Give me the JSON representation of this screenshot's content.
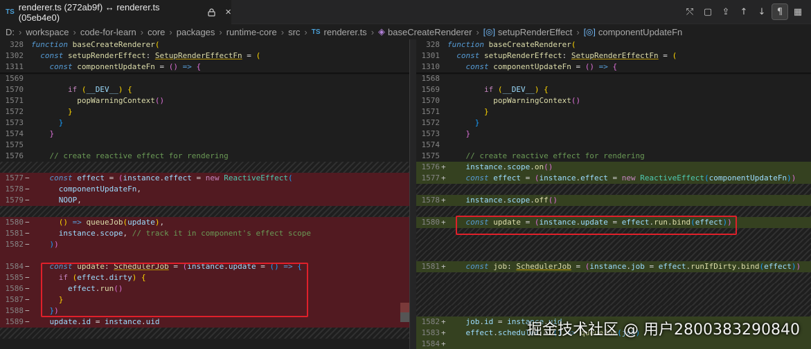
{
  "tab": {
    "title": "renderer.ts (272ab9f) ↔ renderer.ts (05eb4e0)",
    "type_badge": "TS",
    "close_glyph": "×",
    "lock_icon": "lock-icon"
  },
  "toolbar": {
    "actions": [
      {
        "name": "open-changes-icon",
        "glyph": "⤲"
      },
      {
        "name": "open-file-icon",
        "glyph": "▢"
      },
      {
        "name": "stage-icon",
        "glyph": "⇪"
      },
      {
        "name": "prev-change-icon",
        "glyph": "↑"
      },
      {
        "name": "next-change-icon",
        "glyph": "↓"
      },
      {
        "name": "pilcrow-icon",
        "glyph": "¶"
      },
      {
        "name": "map-icon",
        "glyph": "▦"
      }
    ]
  },
  "breadcrumb": {
    "segments": [
      "D:",
      "workspace",
      "code-for-learn",
      "core",
      "packages",
      "runtime-core",
      "src"
    ],
    "file": "renderer.ts",
    "symbols": [
      "baseCreateRenderer",
      "setupRenderEffect",
      "componentUpdateFn"
    ],
    "file_badge": "TS"
  },
  "left": {
    "sticky": [
      {
        "ln": "328",
        "html": "<span class='kw'>function</span> <span class='fn'>baseCreateRenderer</span><span class='p1'>(</span>"
      },
      {
        "ln": "1302",
        "html": "  <span class='kw'>const</span> <span class='fn'>setupRenderEffect</span>: <span class='ty'>SetupRenderEffectFn</span> = <span class='p1'>(</span>"
      },
      {
        "ln": "1311",
        "html": "    <span class='kw'>const</span> <span class='fn'>componentUpdateFn</span> = <span class='p2'>()</span> <span class='kw'>=></span> <span class='p2'>{</span>"
      }
    ],
    "lines": [
      {
        "ln": "1569",
        "mk": "",
        "cls": "",
        "html": ""
      },
      {
        "ln": "1570",
        "mk": "",
        "cls": "",
        "html": "        <span class='kw2'>if</span> <span class='p1'>(</span><span class='va'>__DEV__</span><span class='p1'>)</span> <span class='p1'>{</span>"
      },
      {
        "ln": "1571",
        "mk": "",
        "cls": "",
        "html": "          <span class='fn'>popWarningContext</span><span class='p2'>()</span>"
      },
      {
        "ln": "1572",
        "mk": "",
        "cls": "",
        "html": "        <span class='p1'>}</span>"
      },
      {
        "ln": "1573",
        "mk": "",
        "cls": "",
        "html": "      <span class='p3'>}</span>"
      },
      {
        "ln": "1574",
        "mk": "",
        "cls": "",
        "html": "    <span class='p2'>}</span>"
      },
      {
        "ln": "1575",
        "mk": "",
        "cls": "",
        "html": ""
      },
      {
        "ln": "1576",
        "mk": "",
        "cls": "",
        "html": "    <span class='cm'>// create reactive effect for rendering</span>"
      },
      {
        "ln": "",
        "mk": "",
        "cls": "hatch",
        "html": ""
      },
      {
        "ln": "1577",
        "mk": "−",
        "cls": "del",
        "html": "    <span class='kw'>const</span> <span class='va'>effect</span> = <span class='p2'>(</span><span class='va'>instance</span>.<span class='va'>effect</span> = <span class='kw2'>new</span> <span class='gt'>ReactiveEffect</span><span class='p3'>(</span>"
      },
      {
        "ln": "1578",
        "mk": "−",
        "cls": "del",
        "html": "      <span class='va'>componentUpdateFn</span>,"
      },
      {
        "ln": "1579",
        "mk": "−",
        "cls": "del",
        "html": "      <span class='va'>NOOP</span>,"
      },
      {
        "ln": "",
        "mk": "",
        "cls": "hatch",
        "html": ""
      },
      {
        "ln": "1580",
        "mk": "−",
        "cls": "del",
        "html": "      <span class='p1'>()</span> <span class='kw'>=></span> <span class='fn'>queueJob</span><span class='p1'>(</span><span class='va'>update</span><span class='p1'>)</span>,"
      },
      {
        "ln": "1581",
        "mk": "−",
        "cls": "del",
        "html": "      <span class='va'>instance</span>.<span class='va'>scope</span>, <span class='cm'>// track it in component's effect scope</span>"
      },
      {
        "ln": "1582",
        "mk": "−",
        "cls": "del",
        "html": "    <span class='p3'>)</span><span class='p2'>)</span>"
      },
      {
        "ln": "",
        "mk": "",
        "cls": "del",
        "html": ""
      },
      {
        "ln": "1584",
        "mk": "−",
        "cls": "del",
        "html": "    <span class='kw'>const</span> <span class='fn'>update</span>: <span class='ty'>SchedulerJob</span> = <span class='p2'>(</span><span class='va'>instance</span>.<span class='va'>update</span> = <span class='p3'>()</span> <span class='kw'>=></span> <span class='p3'>{</span>"
      },
      {
        "ln": "1585",
        "mk": "−",
        "cls": "del",
        "html": "      <span class='kw2'>if</span> <span class='p1'>(</span><span class='va'>effect</span>.<span class='va'>dirty</span><span class='p1'>)</span> <span class='p1'>{</span>"
      },
      {
        "ln": "1586",
        "mk": "−",
        "cls": "del",
        "html": "        <span class='va'>effect</span>.<span class='fn'>run</span><span class='p2'>()</span>"
      },
      {
        "ln": "1587",
        "mk": "−",
        "cls": "del",
        "html": "      <span class='p1'>}</span>"
      },
      {
        "ln": "1588",
        "mk": "−",
        "cls": "del",
        "html": "    <span class='p3'>}</span><span class='p2'>)</span>"
      },
      {
        "ln": "1589",
        "mk": "−",
        "cls": "del",
        "html": "    <span class='va'>update</span>.<span class='va'>id</span> = <span class='va'>instance</span>.<span class='va'>uid</span>"
      },
      {
        "ln": "",
        "mk": "",
        "cls": "hatch",
        "html": ""
      }
    ]
  },
  "right": {
    "sticky": [
      {
        "ln": "328",
        "html": "<span class='kw'>function</span> <span class='fn'>baseCreateRenderer</span><span class='p1'>(</span>"
      },
      {
        "ln": "1301",
        "html": "  <span class='kw'>const</span> <span class='fn'>setupRenderEffect</span>: <span class='ty'>SetupRenderEffectFn</span> = <span class='p1'>(</span>"
      },
      {
        "ln": "1310",
        "html": "    <span class='kw'>const</span> <span class='fn'>componentUpdateFn</span> = <span class='p2'>()</span> <span class='kw'>=></span> <span class='p2'>{</span>"
      }
    ],
    "lines": [
      {
        "ln": "1568",
        "mk": "",
        "cls": "",
        "html": ""
      },
      {
        "ln": "1569",
        "mk": "",
        "cls": "",
        "html": "        <span class='kw2'>if</span> <span class='p1'>(</span><span class='va'>__DEV__</span><span class='p1'>)</span> <span class='p1'>{</span>"
      },
      {
        "ln": "1570",
        "mk": "",
        "cls": "",
        "html": "          <span class='fn'>popWarningContext</span><span class='p2'>()</span>"
      },
      {
        "ln": "1571",
        "mk": "",
        "cls": "",
        "html": "        <span class='p1'>}</span>"
      },
      {
        "ln": "1572",
        "mk": "",
        "cls": "",
        "html": "      <span class='p3'>}</span>"
      },
      {
        "ln": "1573",
        "mk": "",
        "cls": "",
        "html": "    <span class='p2'>}</span>"
      },
      {
        "ln": "1574",
        "mk": "",
        "cls": "",
        "html": ""
      },
      {
        "ln": "1575",
        "mk": "",
        "cls": "",
        "html": "    <span class='cm'>// create reactive effect for rendering</span>"
      },
      {
        "ln": "1576",
        "mk": "+",
        "cls": "add",
        "html": "    <span class='va'>instance</span>.<span class='va'>scope</span>.<span class='fn'>on</span><span class='p2'>()</span>"
      },
      {
        "ln": "1577",
        "mk": "+",
        "cls": "add",
        "html": "    <span class='kw'>const</span> <span class='va'>effect</span> = <span class='p2'>(</span><span class='va'>instance</span>.<span class='va'>effect</span> = <span class='kw2'>new</span> <span class='gt'>ReactiveEffect</span><span class='p3'>(</span><span class='va'>componentUpdateFn</span><span class='p3'>)</span><span class='p2'>)</span>"
      },
      {
        "ln": "",
        "mk": "",
        "cls": "hatch",
        "html": ""
      },
      {
        "ln": "1578",
        "mk": "+",
        "cls": "add",
        "html": "    <span class='va'>instance</span>.<span class='va'>scope</span>.<span class='fn'>off</span><span class='p2'>()</span>"
      },
      {
        "ln": "",
        "mk": "",
        "cls": "hatch",
        "html": ""
      },
      {
        "ln": "1580",
        "mk": "+",
        "cls": "add",
        "html": "    <span class='kw'>const</span> <span class='fn'>update</span> = <span class='p2'>(</span><span class='va'>instance</span>.<span class='va'>update</span> = <span class='va'>effect</span>.<span class='fn'>run</span>.<span class='fn'>bind</span><span class='p3'>(</span><span class='va'>effect</span><span class='p3'>)</span><span class='p2'>)</span>"
      },
      {
        "ln": "",
        "mk": "",
        "cls": "hatch",
        "html": ""
      },
      {
        "ln": "",
        "mk": "",
        "cls": "hatch",
        "html": ""
      },
      {
        "ln": "",
        "mk": "",
        "cls": "hatch",
        "html": ""
      },
      {
        "ln": "1581",
        "mk": "+",
        "cls": "add",
        "html": "    <span class='kw'>const</span> <span class='fn'>job</span>: <span class='ty'>SchedulerJob</span> = <span class='p2'>(</span><span class='va'>instance</span>.<span class='va'>job</span> = <span class='va'>effect</span>.<span class='fn'>runIfDirty</span>.<span class='fn'>bind</span><span class='p3'>(</span><span class='va'>effect</span><span class='p3'>)</span><span class='p2'>)</span>"
      },
      {
        "ln": "",
        "mk": "",
        "cls": "hatch",
        "html": ""
      },
      {
        "ln": "",
        "mk": "",
        "cls": "hatch",
        "html": ""
      },
      {
        "ln": "",
        "mk": "",
        "cls": "hatch",
        "html": ""
      },
      {
        "ln": "",
        "mk": "",
        "cls": "hatch",
        "html": ""
      },
      {
        "ln": "1582",
        "mk": "+",
        "cls": "add",
        "html": "    <span class='va'>job</span>.<span class='va'>id</span> = <span class='va'>instance</span>.<span class='va'>uid</span>"
      },
      {
        "ln": "1583",
        "mk": "+",
        "cls": "add",
        "html": "    <span class='va'>effect</span>.<span class='va'>scheduler</span> = <span class='p3'>()</span> <span class='kw'>=></span> <span class='fn'>queueJob</span><span class='p3'>(</span><span class='va'>job</span><span class='p3'>)</span>"
      },
      {
        "ln": "1584",
        "mk": "+",
        "cls": "add",
        "html": ""
      }
    ]
  },
  "watermark": "掘金技术社区 @ 用户2800383290840"
}
